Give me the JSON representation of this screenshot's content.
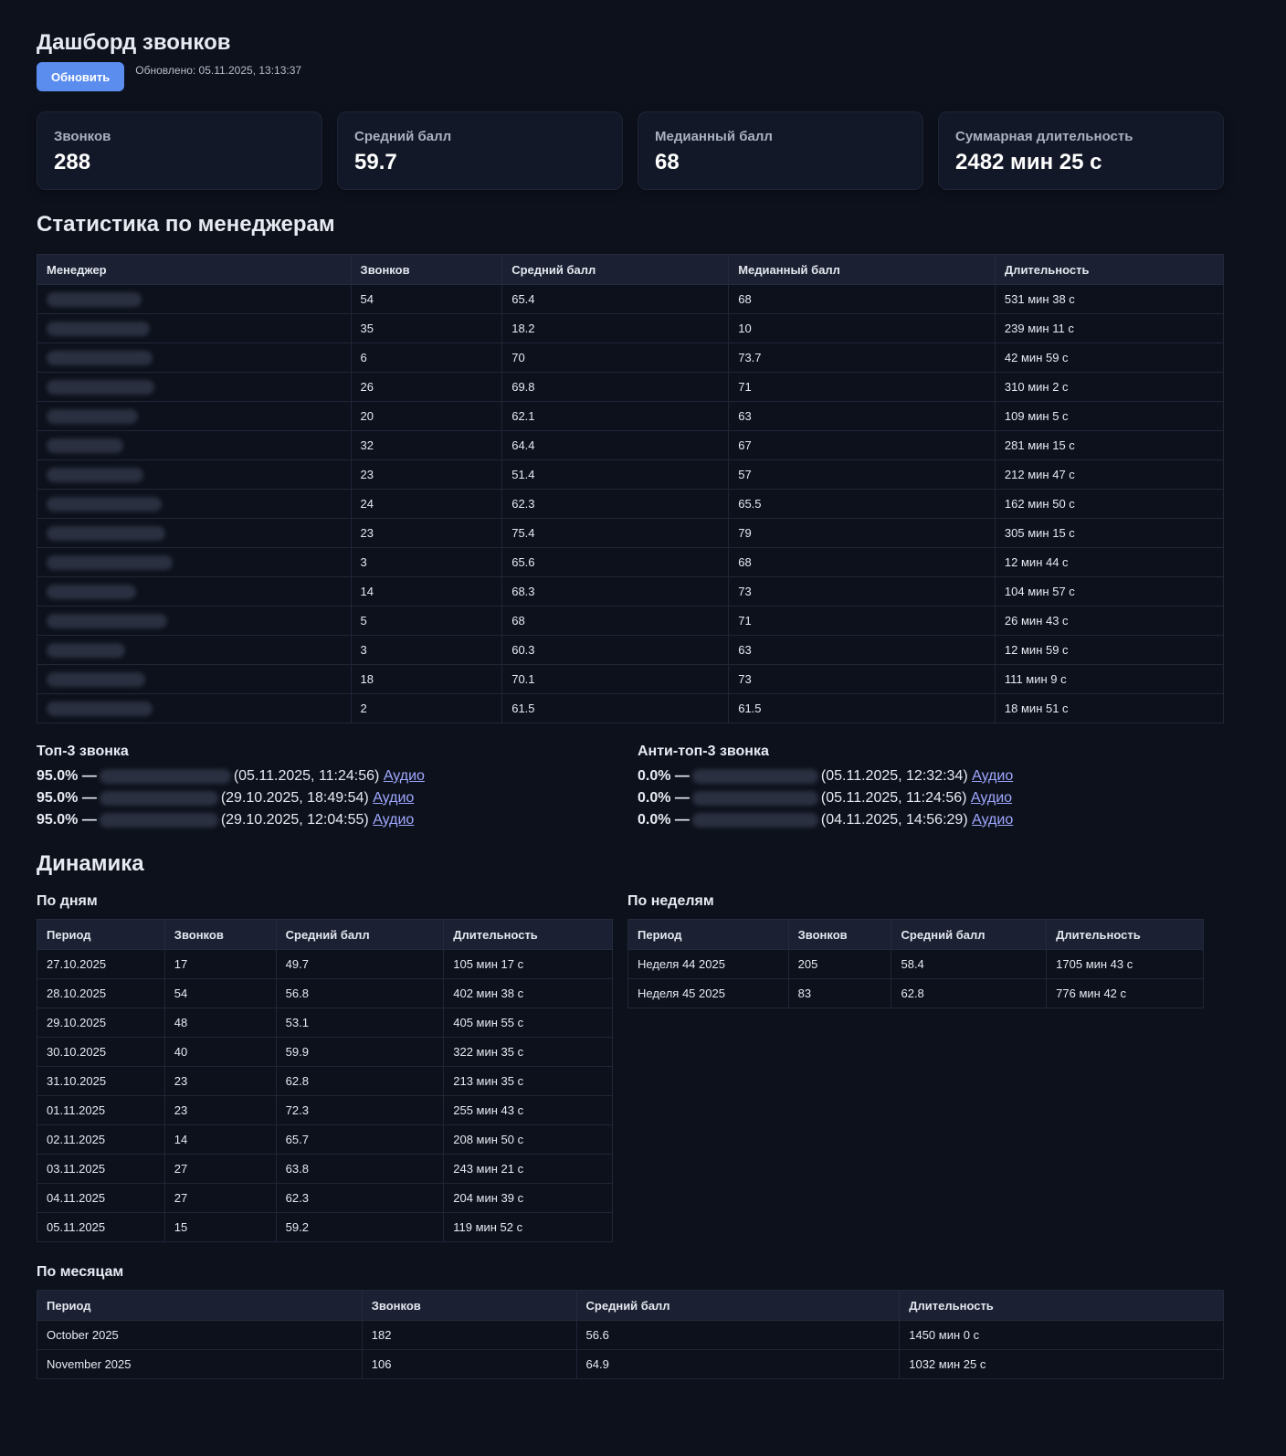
{
  "header": {
    "title": "Дашборд звонков",
    "refresh_label": "Обновить",
    "updated": "Обновлено: 05.11.2025, 13:13:37"
  },
  "cards": [
    {
      "label": "Звонков",
      "value": "288"
    },
    {
      "label": "Средний балл",
      "value": "59.7"
    },
    {
      "label": "Медианный балл",
      "value": "68"
    },
    {
      "label": "Суммарная длительность",
      "value": "2482 мин 25 с"
    }
  ],
  "managers": {
    "title": "Статистика по менеджерам",
    "headers": [
      "Менеджер",
      "Звонков",
      "Средний балл",
      "Медианный балл",
      "Длительность"
    ],
    "rows": [
      [
        "54",
        "65.4",
        "68",
        "531 мин 38 с"
      ],
      [
        "35",
        "18.2",
        "10",
        "239 мин 11 с"
      ],
      [
        "6",
        "70",
        "73.7",
        "42 мин 59 с"
      ],
      [
        "26",
        "69.8",
        "71",
        "310 мин 2 с"
      ],
      [
        "20",
        "62.1",
        "63",
        "109 мин 5 с"
      ],
      [
        "32",
        "64.4",
        "67",
        "281 мин 15 с"
      ],
      [
        "23",
        "51.4",
        "57",
        "212 мин 47 с"
      ],
      [
        "24",
        "62.3",
        "65.5",
        "162 мин 50 с"
      ],
      [
        "23",
        "75.4",
        "79",
        "305 мин 15 с"
      ],
      [
        "3",
        "65.6",
        "68",
        "12 мин 44 с"
      ],
      [
        "14",
        "68.3",
        "73",
        "104 мин 57 с"
      ],
      [
        "5",
        "68",
        "71",
        "26 мин 43 с"
      ],
      [
        "3",
        "60.3",
        "63",
        "12 мин 59 с"
      ],
      [
        "18",
        "70.1",
        "73",
        "111 мин 9 с"
      ],
      [
        "2",
        "61.5",
        "61.5",
        "18 мин 51 с"
      ]
    ]
  },
  "top3": {
    "title": "Топ-3 звонка",
    "items": [
      {
        "score": "95.0%",
        "dash": "—",
        "time": "(05.11.2025, 11:24:56)",
        "link": "Аудио"
      },
      {
        "score": "95.0%",
        "dash": "—",
        "time": "(29.10.2025, 18:49:54)",
        "link": "Аудио"
      },
      {
        "score": "95.0%",
        "dash": "—",
        "time": "(29.10.2025, 12:04:55)",
        "link": "Аудио"
      }
    ]
  },
  "antitop3": {
    "title": "Анти-топ-3 звонка",
    "items": [
      {
        "score": "0.0%",
        "dash": "—",
        "time": "(05.11.2025, 12:32:34)",
        "link": "Аудио"
      },
      {
        "score": "0.0%",
        "dash": "—",
        "time": "(05.11.2025, 11:24:56)",
        "link": "Аудио"
      },
      {
        "score": "0.0%",
        "dash": "—",
        "time": "(04.11.2025, 14:56:29)",
        "link": "Аудио"
      }
    ]
  },
  "dynamics": {
    "title": "Динамика",
    "by_days": {
      "title": "По дням",
      "headers": [
        "Период",
        "Звонков",
        "Средний балл",
        "Длительность"
      ],
      "rows": [
        [
          "27.10.2025",
          "17",
          "49.7",
          "105 мин 17 с"
        ],
        [
          "28.10.2025",
          "54",
          "56.8",
          "402 мин 38 с"
        ],
        [
          "29.10.2025",
          "48",
          "53.1",
          "405 мин 55 с"
        ],
        [
          "30.10.2025",
          "40",
          "59.9",
          "322 мин 35 с"
        ],
        [
          "31.10.2025",
          "23",
          "62.8",
          "213 мин 35 с"
        ],
        [
          "01.11.2025",
          "23",
          "72.3",
          "255 мин 43 с"
        ],
        [
          "02.11.2025",
          "14",
          "65.7",
          "208 мин 50 с"
        ],
        [
          "03.11.2025",
          "27",
          "63.8",
          "243 мин 21 с"
        ],
        [
          "04.11.2025",
          "27",
          "62.3",
          "204 мин 39 с"
        ],
        [
          "05.11.2025",
          "15",
          "59.2",
          "119 мин 52 с"
        ]
      ]
    },
    "by_weeks": {
      "title": "По неделям",
      "headers": [
        "Период",
        "Звонков",
        "Средний балл",
        "Длительность"
      ],
      "rows": [
        [
          "Неделя 44 2025",
          "205",
          "58.4",
          "1705 мин 43 с"
        ],
        [
          "Неделя 45 2025",
          "83",
          "62.8",
          "776 мин 42 с"
        ]
      ]
    },
    "by_months": {
      "title": "По месяцам",
      "headers": [
        "Период",
        "Звонков",
        "Средний балл",
        "Длительность"
      ],
      "rows": [
        [
          "October 2025",
          "182",
          "56.6",
          "1450 мин 0 с"
        ],
        [
          "November 2025",
          "106",
          "64.9",
          "1032 мин 25 с"
        ]
      ]
    }
  }
}
